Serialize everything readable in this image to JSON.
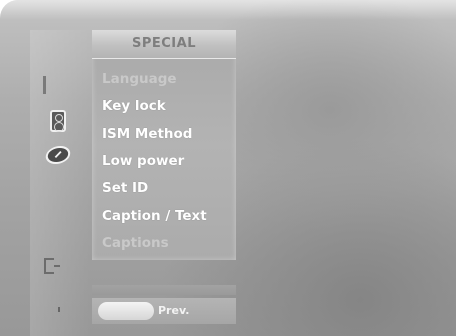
{
  "menu": {
    "title": "SPECIAL",
    "items": [
      {
        "label": "Language",
        "state": "disabled"
      },
      {
        "label": "Key lock",
        "state": "enabled"
      },
      {
        "label": "ISM Method",
        "state": "enabled"
      },
      {
        "label": "Low power",
        "state": "enabled"
      },
      {
        "label": "Set ID",
        "state": "enabled"
      },
      {
        "label": "Caption / Text",
        "state": "enabled"
      },
      {
        "label": "Captions",
        "state": "disabled"
      }
    ]
  },
  "footer": {
    "prev_label": "Prev."
  },
  "icons": [
    "menu-bar-icon",
    "speaker-icon",
    "clock-icon",
    "input-bracket-icon"
  ]
}
